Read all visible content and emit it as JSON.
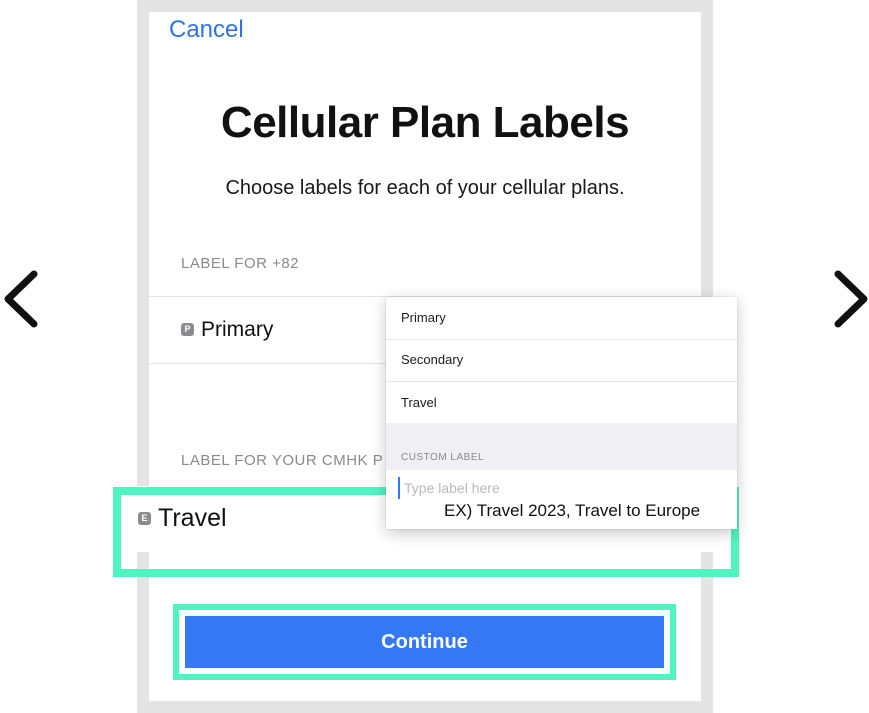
{
  "navigation": {
    "prev_icon": "chevron-left-icon",
    "next_icon": "chevron-right-icon"
  },
  "screen": {
    "cancel_label": "Cancel",
    "title": "Cellular Plan Labels",
    "subtitle": "Choose labels for each of your cellular plans."
  },
  "plans": [
    {
      "section_header": "LABEL FOR +82",
      "badge": "P",
      "label": "Primary"
    },
    {
      "section_header": "LABEL FOR YOUR CMHK P",
      "badge": "E",
      "label": "Travel"
    }
  ],
  "dropdown": {
    "options": [
      "Primary",
      "Secondary",
      "Travel"
    ],
    "custom_header": "CUSTOM LABEL",
    "custom_placeholder": "Type label here",
    "example_note": "EX) Travel 2023, Travel to Europe"
  },
  "continue_label": "Continue",
  "colors": {
    "accent": "#3478f6",
    "link": "#2f74e0",
    "highlight": "#4ef5c0",
    "badge": "#8c8c90"
  }
}
